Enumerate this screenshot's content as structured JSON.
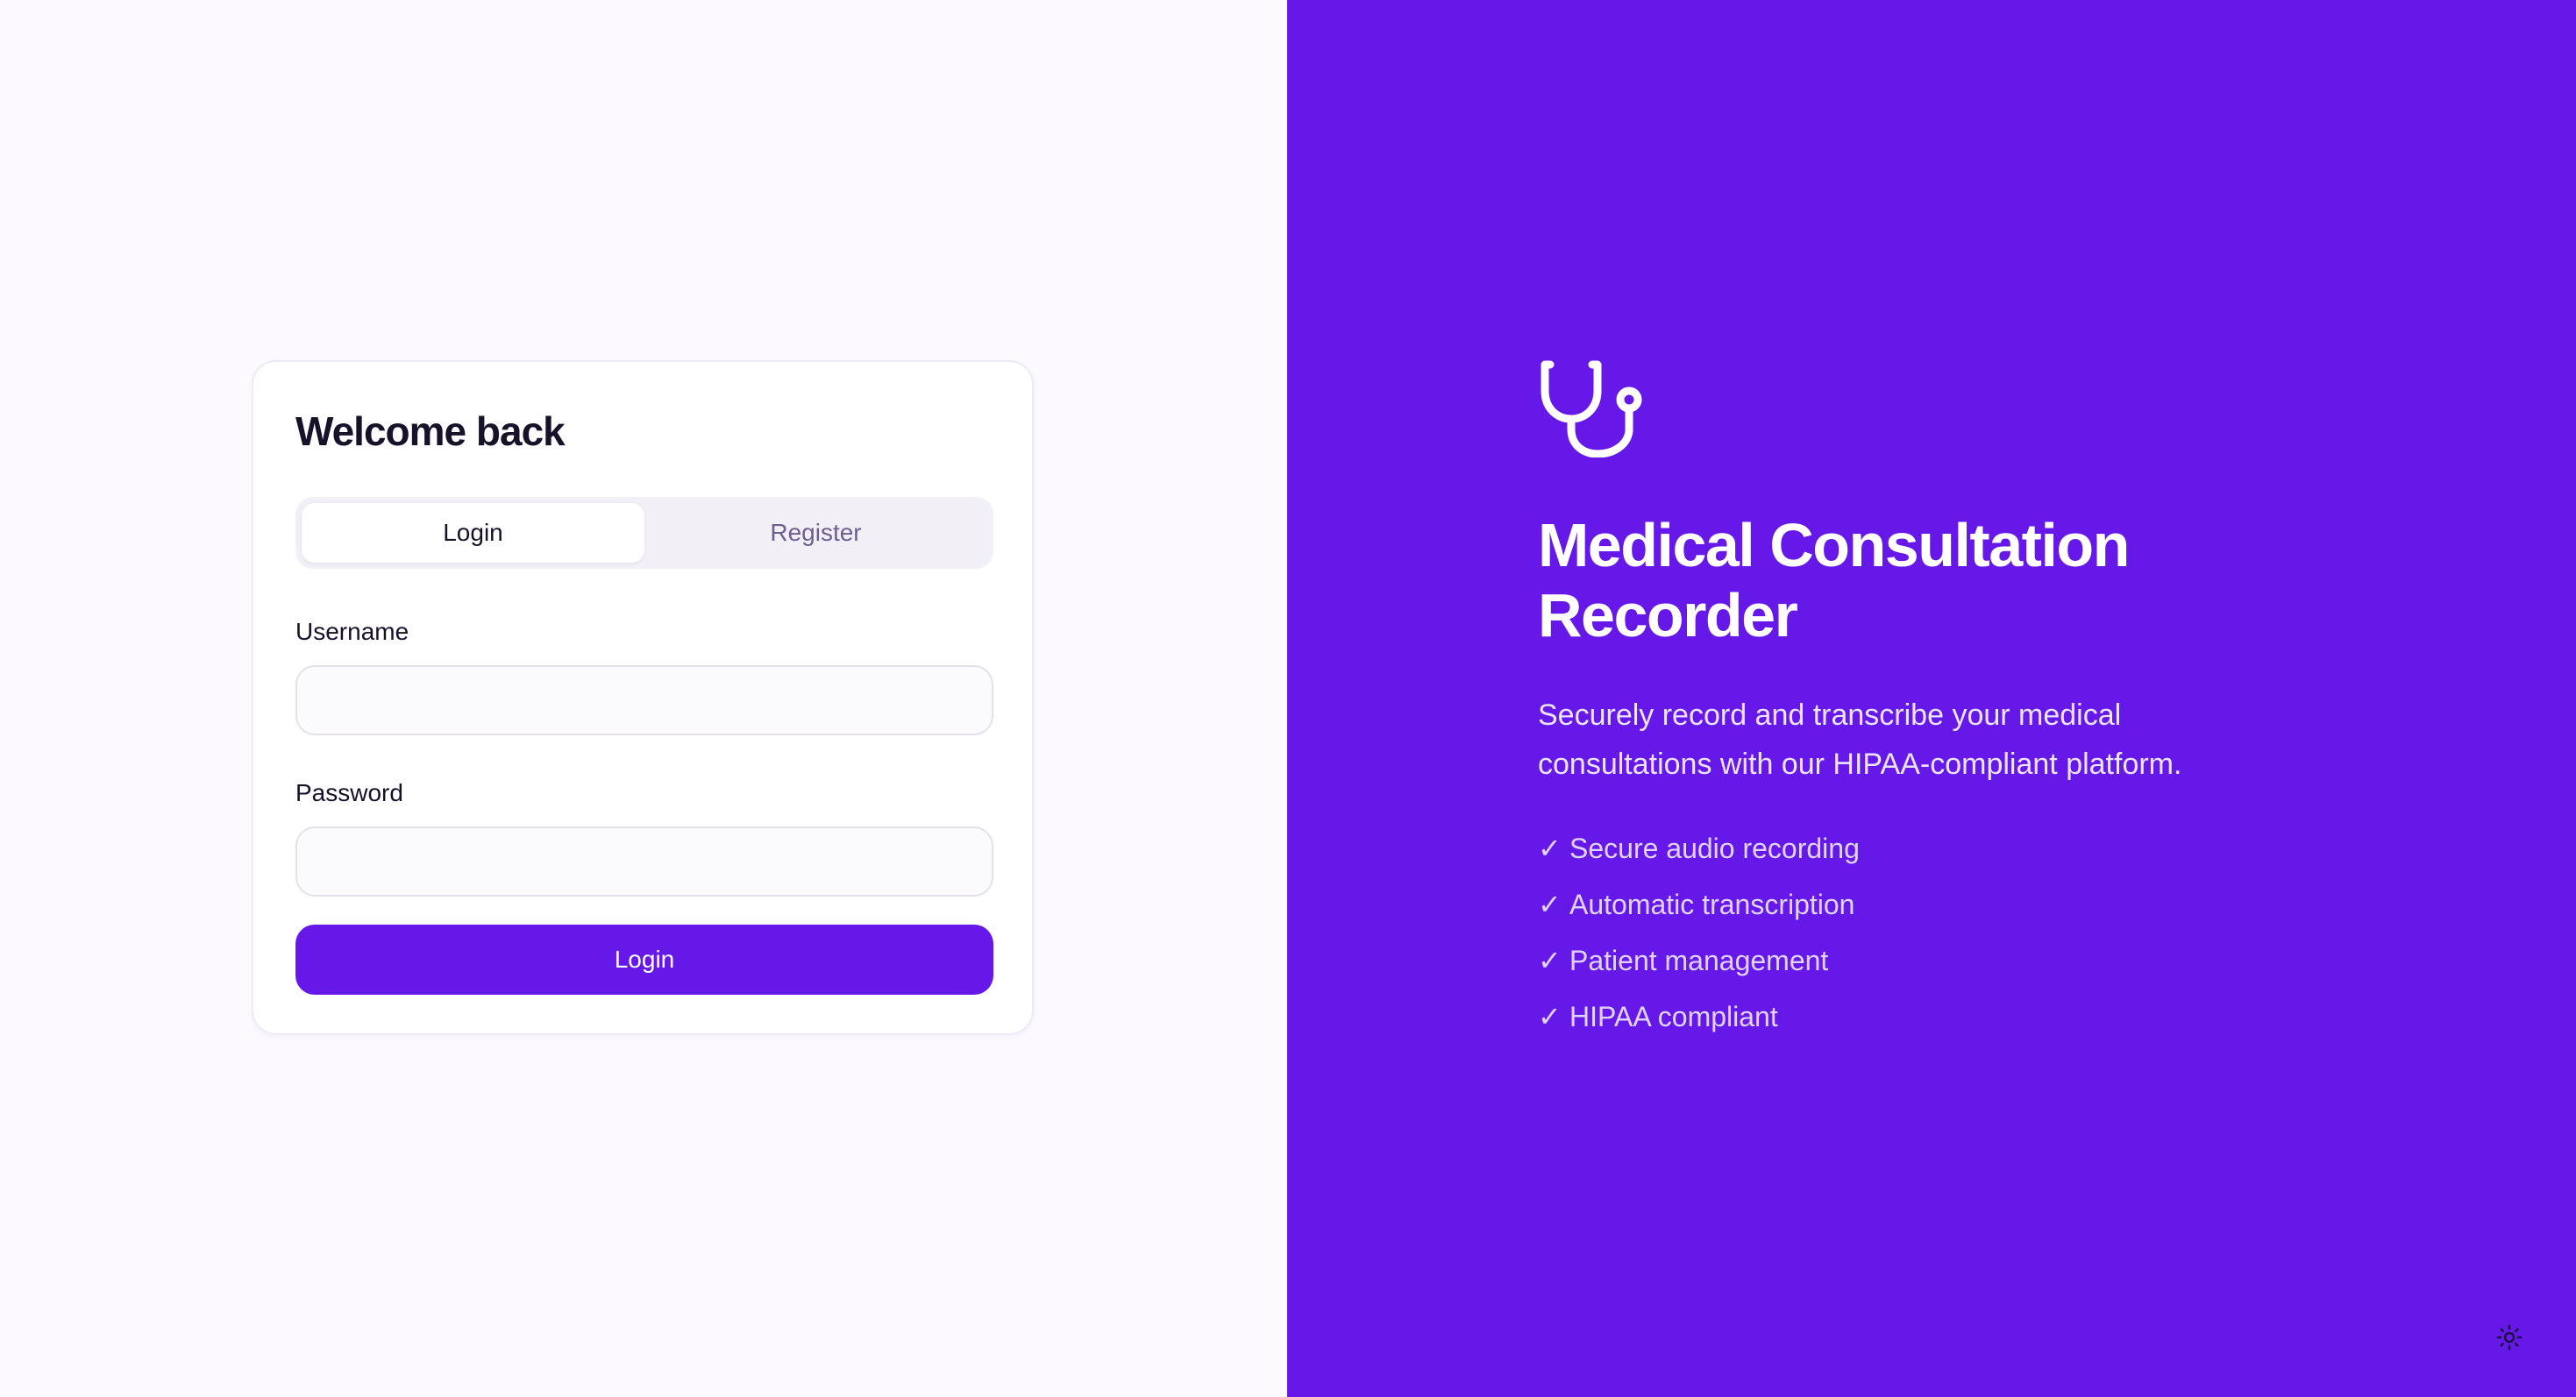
{
  "auth_card": {
    "title": "Welcome back",
    "tabs": [
      {
        "label": "Login",
        "active": true
      },
      {
        "label": "Register",
        "active": false
      }
    ],
    "username": {
      "label": "Username",
      "value": "",
      "placeholder": ""
    },
    "password": {
      "label": "Password",
      "value": "",
      "placeholder": ""
    },
    "submit_label": "Login"
  },
  "hero": {
    "icon": "stethoscope-icon",
    "title": "Medical Consultation Recorder",
    "description": "Securely record and transcribe your medical consultations with our HIPAA-compliant platform.",
    "check_glyph": "✓",
    "features": [
      "Secure audio recording",
      "Automatic transcription",
      "Patient management",
      "HIPAA compliant"
    ]
  },
  "theme_toggle": {
    "icon": "sun-icon"
  },
  "colors": {
    "accent": "#6518e8",
    "left_background": "#fcfaff",
    "text_dark": "#17112a",
    "tab_inactive_text": "#6e5e91"
  }
}
